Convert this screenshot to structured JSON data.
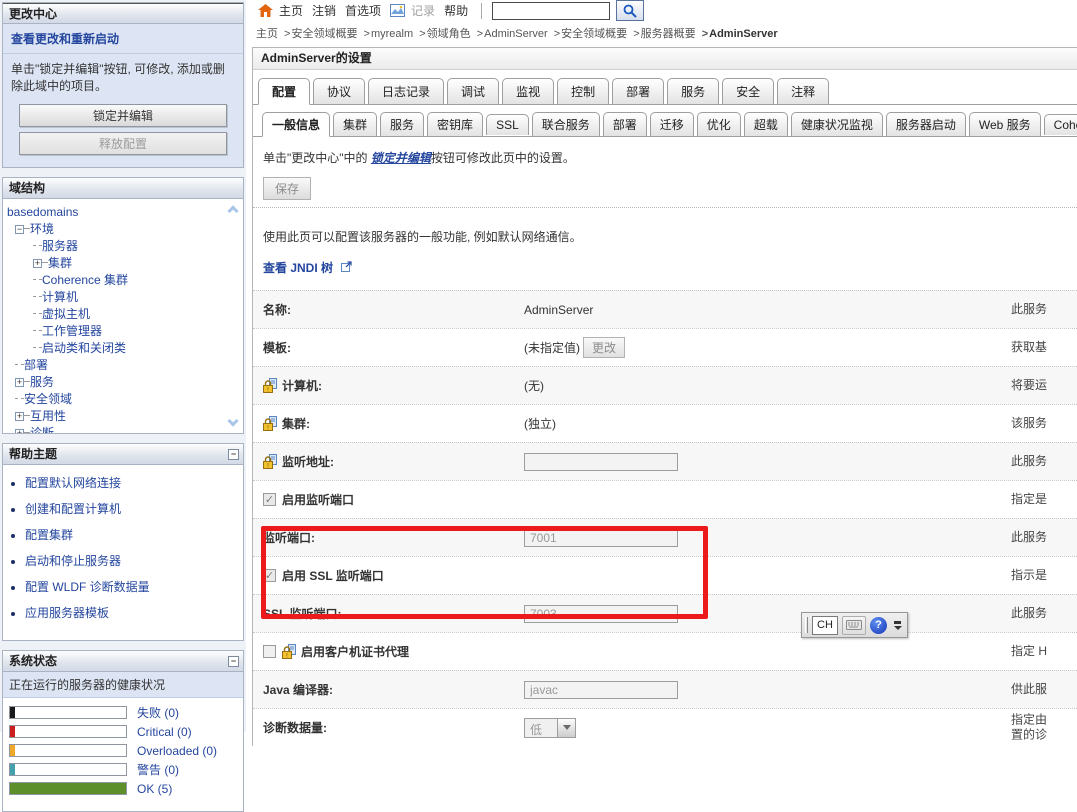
{
  "topbar": {
    "home": "主页",
    "logout": "注销",
    "preferences": "首选项",
    "record": "记录",
    "help": "帮助",
    "search_value": ""
  },
  "breadcrumb": {
    "items": [
      "主页",
      "安全领域概要",
      "myrealm",
      "领域角色",
      "AdminServer",
      "安全领域概要",
      "服务器概要",
      "AdminServer"
    ]
  },
  "change_center": {
    "title": "更改中心",
    "view_link": "查看更改和重新启动",
    "description": "单击\"锁定并编辑\"按钮, 可修改, 添加或删除此域中的项目。",
    "lock_button": "锁定并编辑",
    "release_button": "释放配置"
  },
  "domain_structure": {
    "title": "域结构",
    "root": "basedomains",
    "items": [
      {
        "label": "环境"
      },
      {
        "label": "服务器"
      },
      {
        "label": "集群"
      },
      {
        "label": "Coherence 集群"
      },
      {
        "label": "计算机"
      },
      {
        "label": "虚拟主机"
      },
      {
        "label": "工作管理器"
      },
      {
        "label": "启动类和关闭类"
      },
      {
        "label": "部署"
      },
      {
        "label": "服务"
      },
      {
        "label": "安全领域"
      },
      {
        "label": "互用性"
      },
      {
        "label": "诊断"
      }
    ]
  },
  "help_topics": {
    "title": "帮助主题",
    "links": [
      "配置默认网络连接",
      "创建和配置计算机",
      "配置集群",
      "启动和停止服务器",
      "配置 WLDF 诊断数据量",
      "应用服务器模板"
    ]
  },
  "system_status": {
    "title": "系统状态",
    "subtitle": "正在运行的服务器的健康状况",
    "gauges": [
      {
        "label": "失败 (0)",
        "color": "#1a1a1a",
        "fill": 4
      },
      {
        "label": "Critical (0)",
        "color": "#cc2020",
        "fill": 4
      },
      {
        "label": "Overloaded (0)",
        "color": "#efa829",
        "fill": 4
      },
      {
        "label": "警告 (0)",
        "color": "#45a0ae",
        "fill": 4
      },
      {
        "label": "OK (5)",
        "color": "#5c8e2a",
        "fill": 100
      }
    ]
  },
  "page": {
    "title": "AdminServer的设置"
  },
  "tabs_primary": [
    "配置",
    "协议",
    "日志记录",
    "调试",
    "监视",
    "控制",
    "部署",
    "服务",
    "安全",
    "注释"
  ],
  "tabs_secondary": [
    "一般信息",
    "集群",
    "服务",
    "密钥库",
    "SSL",
    "联合服务",
    "部署",
    "迁移",
    "优化",
    "超载",
    "健康状况监视",
    "服务器启动",
    "Web 服务",
    "Coherence"
  ],
  "notice": {
    "prefix": "单击\"更改中心\"中的 ",
    "link": "锁定并编辑",
    "suffix": "按钮可修改此页中的设置。"
  },
  "save_button": "保存",
  "intro": "使用此页可以配置该服务器的一般功能, 例如默认网络通信。",
  "jndi_link": "查看 JNDI 树",
  "form": {
    "rows": [
      {
        "label": "名称:",
        "value": "AdminServer",
        "desc": "此服务"
      },
      {
        "label": "模板:",
        "value": "(未指定值)",
        "button": "更改",
        "desc": "获取基"
      },
      {
        "label": "计算机:",
        "value": "(无)",
        "desc": "将要运"
      },
      {
        "label": "集群:",
        "value": "(独立)",
        "desc": "该服务"
      },
      {
        "label": "监听地址:",
        "input": "",
        "desc": "此服务"
      },
      {
        "label": "启用监听端口",
        "desc": "指定是"
      },
      {
        "label": "监听端口:",
        "input": "7001",
        "desc": "此服务"
      },
      {
        "label": "启用 SSL 监听端口",
        "desc": "指示是"
      },
      {
        "label": "SSL 监听端口:",
        "input": "7003",
        "desc": "此服务"
      },
      {
        "label": "启用客户机证书代理",
        "desc": "指定 H"
      },
      {
        "label": "Java 编译器:",
        "input": "javac",
        "desc": "供此服"
      },
      {
        "label": "诊断数据量:",
        "select": "低",
        "desc": "指定由",
        "desc2": "置的诊"
      }
    ]
  },
  "langbar": {
    "lang": "CH"
  },
  "colors": {
    "highlight_red": "#ec1a1a",
    "ok_green": "#5c8e2a",
    "link_blue": "#24469e"
  }
}
